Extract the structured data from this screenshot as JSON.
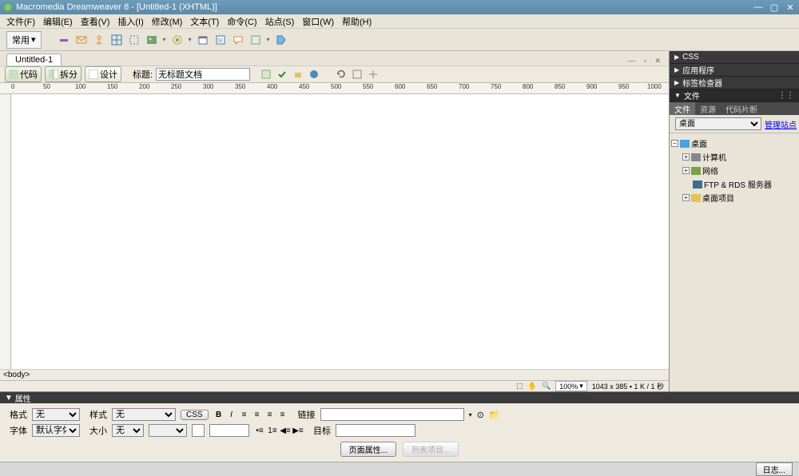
{
  "window": {
    "title": "Macromedia Dreamweaver 8 - [Untitled-1 (XHTML)]"
  },
  "menu": [
    "文件(F)",
    "编辑(E)",
    "查看(V)",
    "插入(I)",
    "修改(M)",
    "文本(T)",
    "命令(C)",
    "站点(S)",
    "窗口(W)",
    "帮助(H)"
  ],
  "toolbar": {
    "common_label": "常用"
  },
  "document": {
    "tab": "Untitled-1",
    "view_code": "代码",
    "view_split": "拆分",
    "view_design": "设计",
    "title_label": "标题:",
    "title_value": "无标题文档",
    "tag_selector": "<body>",
    "zoom": "100%",
    "status": "1043 x 385 ▪ 1 K / 1 秒"
  },
  "ruler_h": [
    "0",
    "50",
    "100",
    "150",
    "200",
    "250",
    "300",
    "350",
    "400",
    "450",
    "500",
    "550",
    "600",
    "650",
    "700",
    "750",
    "800",
    "850",
    "900",
    "950",
    "1000"
  ],
  "panels": {
    "css": "CSS",
    "app": "应用程序",
    "tags": "标签检查器",
    "files": "文件",
    "file_tabs": {
      "files": "文件",
      "assets": "资源",
      "snippets": "代码片断"
    },
    "drop_value": "桌面",
    "manage_link": "管理站点",
    "tree": {
      "root": "桌面",
      "computer": "计算机",
      "network": "网络",
      "ftp": "FTP & RDS 服务器",
      "items": "桌面项目"
    }
  },
  "properties": {
    "header": "属性",
    "format_label": "格式",
    "format_value": "无",
    "style_label": "样式",
    "style_value": "无",
    "css_btn": "CSS",
    "link_label": "链接",
    "font_label": "字体",
    "font_value": "默认字体",
    "size_label": "大小",
    "size_value": "无",
    "target_label": "目标",
    "page_props": "页面属性...",
    "list_items": "列表项目..."
  },
  "footer": {
    "log": "日志..."
  }
}
